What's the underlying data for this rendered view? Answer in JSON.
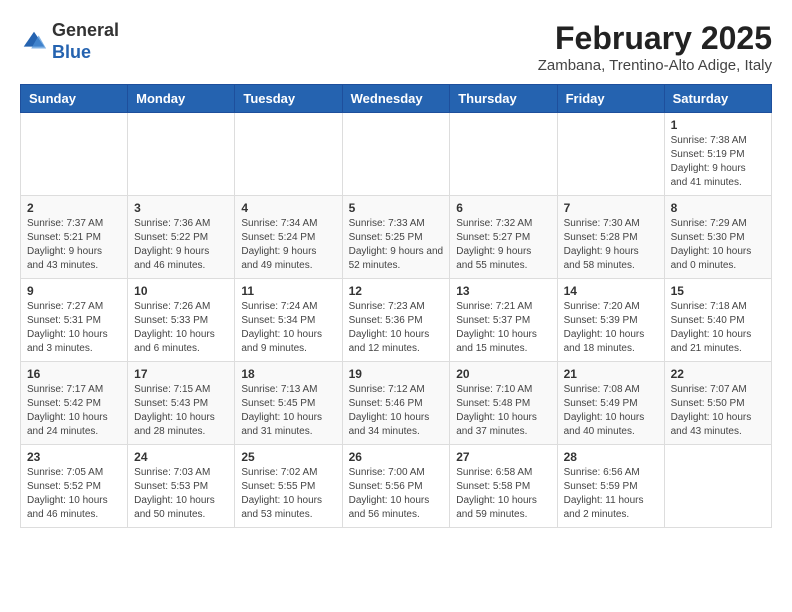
{
  "header": {
    "logo": {
      "general": "General",
      "blue": "Blue"
    },
    "title": "February 2025",
    "location": "Zambana, Trentino-Alto Adige, Italy"
  },
  "calendar": {
    "days_of_week": [
      "Sunday",
      "Monday",
      "Tuesday",
      "Wednesday",
      "Thursday",
      "Friday",
      "Saturday"
    ],
    "weeks": [
      [
        {
          "day": "",
          "info": ""
        },
        {
          "day": "",
          "info": ""
        },
        {
          "day": "",
          "info": ""
        },
        {
          "day": "",
          "info": ""
        },
        {
          "day": "",
          "info": ""
        },
        {
          "day": "",
          "info": ""
        },
        {
          "day": "1",
          "info": "Sunrise: 7:38 AM\nSunset: 5:19 PM\nDaylight: 9 hours and 41 minutes."
        }
      ],
      [
        {
          "day": "2",
          "info": "Sunrise: 7:37 AM\nSunset: 5:21 PM\nDaylight: 9 hours and 43 minutes."
        },
        {
          "day": "3",
          "info": "Sunrise: 7:36 AM\nSunset: 5:22 PM\nDaylight: 9 hours and 46 minutes."
        },
        {
          "day": "4",
          "info": "Sunrise: 7:34 AM\nSunset: 5:24 PM\nDaylight: 9 hours and 49 minutes."
        },
        {
          "day": "5",
          "info": "Sunrise: 7:33 AM\nSunset: 5:25 PM\nDaylight: 9 hours and 52 minutes."
        },
        {
          "day": "6",
          "info": "Sunrise: 7:32 AM\nSunset: 5:27 PM\nDaylight: 9 hours and 55 minutes."
        },
        {
          "day": "7",
          "info": "Sunrise: 7:30 AM\nSunset: 5:28 PM\nDaylight: 9 hours and 58 minutes."
        },
        {
          "day": "8",
          "info": "Sunrise: 7:29 AM\nSunset: 5:30 PM\nDaylight: 10 hours and 0 minutes."
        }
      ],
      [
        {
          "day": "9",
          "info": "Sunrise: 7:27 AM\nSunset: 5:31 PM\nDaylight: 10 hours and 3 minutes."
        },
        {
          "day": "10",
          "info": "Sunrise: 7:26 AM\nSunset: 5:33 PM\nDaylight: 10 hours and 6 minutes."
        },
        {
          "day": "11",
          "info": "Sunrise: 7:24 AM\nSunset: 5:34 PM\nDaylight: 10 hours and 9 minutes."
        },
        {
          "day": "12",
          "info": "Sunrise: 7:23 AM\nSunset: 5:36 PM\nDaylight: 10 hours and 12 minutes."
        },
        {
          "day": "13",
          "info": "Sunrise: 7:21 AM\nSunset: 5:37 PM\nDaylight: 10 hours and 15 minutes."
        },
        {
          "day": "14",
          "info": "Sunrise: 7:20 AM\nSunset: 5:39 PM\nDaylight: 10 hours and 18 minutes."
        },
        {
          "day": "15",
          "info": "Sunrise: 7:18 AM\nSunset: 5:40 PM\nDaylight: 10 hours and 21 minutes."
        }
      ],
      [
        {
          "day": "16",
          "info": "Sunrise: 7:17 AM\nSunset: 5:42 PM\nDaylight: 10 hours and 24 minutes."
        },
        {
          "day": "17",
          "info": "Sunrise: 7:15 AM\nSunset: 5:43 PM\nDaylight: 10 hours and 28 minutes."
        },
        {
          "day": "18",
          "info": "Sunrise: 7:13 AM\nSunset: 5:45 PM\nDaylight: 10 hours and 31 minutes."
        },
        {
          "day": "19",
          "info": "Sunrise: 7:12 AM\nSunset: 5:46 PM\nDaylight: 10 hours and 34 minutes."
        },
        {
          "day": "20",
          "info": "Sunrise: 7:10 AM\nSunset: 5:48 PM\nDaylight: 10 hours and 37 minutes."
        },
        {
          "day": "21",
          "info": "Sunrise: 7:08 AM\nSunset: 5:49 PM\nDaylight: 10 hours and 40 minutes."
        },
        {
          "day": "22",
          "info": "Sunrise: 7:07 AM\nSunset: 5:50 PM\nDaylight: 10 hours and 43 minutes."
        }
      ],
      [
        {
          "day": "23",
          "info": "Sunrise: 7:05 AM\nSunset: 5:52 PM\nDaylight: 10 hours and 46 minutes."
        },
        {
          "day": "24",
          "info": "Sunrise: 7:03 AM\nSunset: 5:53 PM\nDaylight: 10 hours and 50 minutes."
        },
        {
          "day": "25",
          "info": "Sunrise: 7:02 AM\nSunset: 5:55 PM\nDaylight: 10 hours and 53 minutes."
        },
        {
          "day": "26",
          "info": "Sunrise: 7:00 AM\nSunset: 5:56 PM\nDaylight: 10 hours and 56 minutes."
        },
        {
          "day": "27",
          "info": "Sunrise: 6:58 AM\nSunset: 5:58 PM\nDaylight: 10 hours and 59 minutes."
        },
        {
          "day": "28",
          "info": "Sunrise: 6:56 AM\nSunset: 5:59 PM\nDaylight: 11 hours and 2 minutes."
        },
        {
          "day": "",
          "info": ""
        }
      ]
    ]
  }
}
